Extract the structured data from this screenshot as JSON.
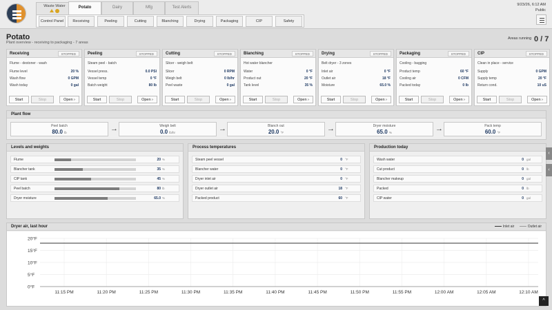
{
  "header": {
    "alert_tab_label": "Waste Water",
    "tabs": [
      {
        "label": "Potato",
        "active": true
      },
      {
        "label": "Dairy",
        "active": false
      },
      {
        "label": "Mfg",
        "active": false
      },
      {
        "label": "Test Alerts",
        "active": false
      }
    ],
    "nav": [
      "Control Panel",
      "Receiving",
      "Peeling",
      "Cutting",
      "Blanching",
      "Drying",
      "Packaging",
      "CIP",
      "Safety"
    ],
    "date": "9/23/26, 6:12 AM",
    "user": "Public"
  },
  "page": {
    "title": "Potato",
    "subtitle": "Plant overview - receiving to packaging - 7 areas",
    "areas_label": "Areas running",
    "areas_count": "0 / 7"
  },
  "cards": [
    {
      "title": "Receiving",
      "status": "STOPPED",
      "desc": "Flume - destoner - wash",
      "rows": [
        {
          "label": "Flume level",
          "value": "20 %"
        },
        {
          "label": "Wash flow",
          "value": "0 GPM"
        },
        {
          "label": "Wash today",
          "value": "0 gal"
        }
      ],
      "start": "Start",
      "stop": "Stop",
      "open": "Open ›"
    },
    {
      "title": "Peeling",
      "status": "STOPPED",
      "desc": "Steam peel - batch",
      "rows": [
        {
          "label": "Vessel press.",
          "value": "0.0 PSI"
        },
        {
          "label": "Vessel temp",
          "value": "0 °F"
        },
        {
          "label": "Batch weight",
          "value": "80 lb"
        }
      ],
      "start": "Start",
      "stop": "Stop",
      "open": "Open ›"
    },
    {
      "title": "Cutting",
      "status": "STOPPED",
      "desc": "Slicer - weigh belt",
      "rows": [
        {
          "label": "Slicer",
          "value": "0 RPM"
        },
        {
          "label": "Weigh belt",
          "value": "0 lb/hr"
        },
        {
          "label": "Peel waste",
          "value": "0 gal"
        }
      ],
      "start": "Start",
      "stop": "Stop",
      "open": "Open ›"
    },
    {
      "title": "Blanching",
      "status": "STOPPED",
      "desc": "Hot water blancher",
      "rows": [
        {
          "label": "Water",
          "value": "0 °F"
        },
        {
          "label": "Product out",
          "value": "20 °F"
        },
        {
          "label": "Tank level",
          "value": "35 %"
        }
      ],
      "start": "Start",
      "stop": "Stop",
      "open": "Open ›"
    },
    {
      "title": "Drying",
      "status": "STOPPED",
      "desc": "Belt dryer - 3 zones",
      "rows": [
        {
          "label": "Inlet air",
          "value": "0 °F"
        },
        {
          "label": "Outlet air",
          "value": "18 °F"
        },
        {
          "label": "Moisture",
          "value": "65.0 %"
        }
      ],
      "start": "Start",
      "stop": "Stop",
      "open": "Open ›"
    },
    {
      "title": "Packaging",
      "status": "STOPPED",
      "desc": "Cooling - bagging",
      "rows": [
        {
          "label": "Product temp",
          "value": "60 °F"
        },
        {
          "label": "Cooling air",
          "value": "0 CFM"
        },
        {
          "label": "Packed today",
          "value": "0 lb"
        }
      ],
      "start": "Start",
      "stop": "Stop",
      "open": "Open ›"
    },
    {
      "title": "CIP",
      "status": "STOPPED",
      "desc": "Clean in place - service",
      "rows": [
        {
          "label": "Supply",
          "value": "0 GPM"
        },
        {
          "label": "Supply temp",
          "value": "20 °F"
        },
        {
          "label": "Return cond.",
          "value": "10 uS"
        }
      ],
      "start": "Start",
      "stop": "Stop",
      "open": "Open ›"
    }
  ],
  "flow": {
    "title": "Plant flow",
    "items": [
      {
        "label": "Peel batch",
        "value": "80.0",
        "unit": "lb"
      },
      {
        "label": "Weigh belt",
        "value": "0.0",
        "unit": "lb/hr"
      },
      {
        "label": "Blanch out",
        "value": "20.0",
        "unit": "°F"
      },
      {
        "label": "Dryer moisture",
        "value": "65.0",
        "unit": "%"
      },
      {
        "label": "Pack temp",
        "value": "60.0",
        "unit": "°F"
      }
    ]
  },
  "levels": {
    "title": "Levels and weights",
    "rows": [
      {
        "label": "Flume",
        "value": "20",
        "unit": "%",
        "fill": 0.2
      },
      {
        "label": "Blancher tank",
        "value": "35",
        "unit": "%",
        "fill": 0.35
      },
      {
        "label": "CIP tank",
        "value": "45",
        "unit": "%",
        "fill": 0.45
      },
      {
        "label": "Peel batch",
        "value": "80",
        "unit": "lb",
        "fill": 0.8
      },
      {
        "label": "Dryer moisture",
        "value": "65.0",
        "unit": "%",
        "fill": 0.65
      }
    ]
  },
  "temps": {
    "title": "Process temperatures",
    "rows": [
      {
        "label": "Steam peel vessel",
        "value": "0",
        "unit": "°F"
      },
      {
        "label": "Blancher water",
        "value": "0",
        "unit": "°F"
      },
      {
        "label": "Dryer inlet air",
        "value": "0",
        "unit": "°F"
      },
      {
        "label": "Dryer outlet air",
        "value": "18",
        "unit": "°F"
      },
      {
        "label": "Packed product",
        "value": "60",
        "unit": "°F"
      }
    ]
  },
  "production": {
    "title": "Production today",
    "rows": [
      {
        "label": "Wash water",
        "value": "0",
        "unit": "gal"
      },
      {
        "label": "Cut product",
        "value": "0",
        "unit": "lb"
      },
      {
        "label": "Blancher makeup",
        "value": "0",
        "unit": "gal"
      },
      {
        "label": "Packed",
        "value": "0",
        "unit": "lb"
      },
      {
        "label": "CIP water",
        "value": "0",
        "unit": "gal"
      }
    ]
  },
  "chart_data": {
    "type": "line",
    "title": "Dryer air, last hour",
    "xlabel": "",
    "ylabel": "",
    "x": [
      "11:15 PM",
      "11:20 PM",
      "11:25 PM",
      "11:30 PM",
      "11:35 PM",
      "11:40 PM",
      "11:45 PM",
      "11:50 PM",
      "11:55 PM",
      "12:00 AM",
      "12:05 AM",
      "12:10 AM"
    ],
    "y_ticks": [
      "0°F",
      "5°F",
      "10°F",
      "15°F",
      "20°F"
    ],
    "ylim": [
      0,
      20
    ],
    "grid": true,
    "legend": "top-right",
    "series": [
      {
        "name": "Inlet air",
        "color": "#333333",
        "values": [
          18,
          18,
          18,
          18,
          18,
          18,
          18,
          18,
          18,
          18,
          18,
          18
        ]
      },
      {
        "name": "Outlet air",
        "color": "#999999",
        "values": [
          18,
          18,
          18,
          18,
          18,
          18,
          18,
          18,
          18,
          18,
          18,
          18
        ]
      }
    ]
  },
  "icons": {
    "alert": "warning-icon",
    "menu": "hamburger-icon",
    "arrow": "arrow-right-icon",
    "scroll": "chevron-up-icon"
  }
}
